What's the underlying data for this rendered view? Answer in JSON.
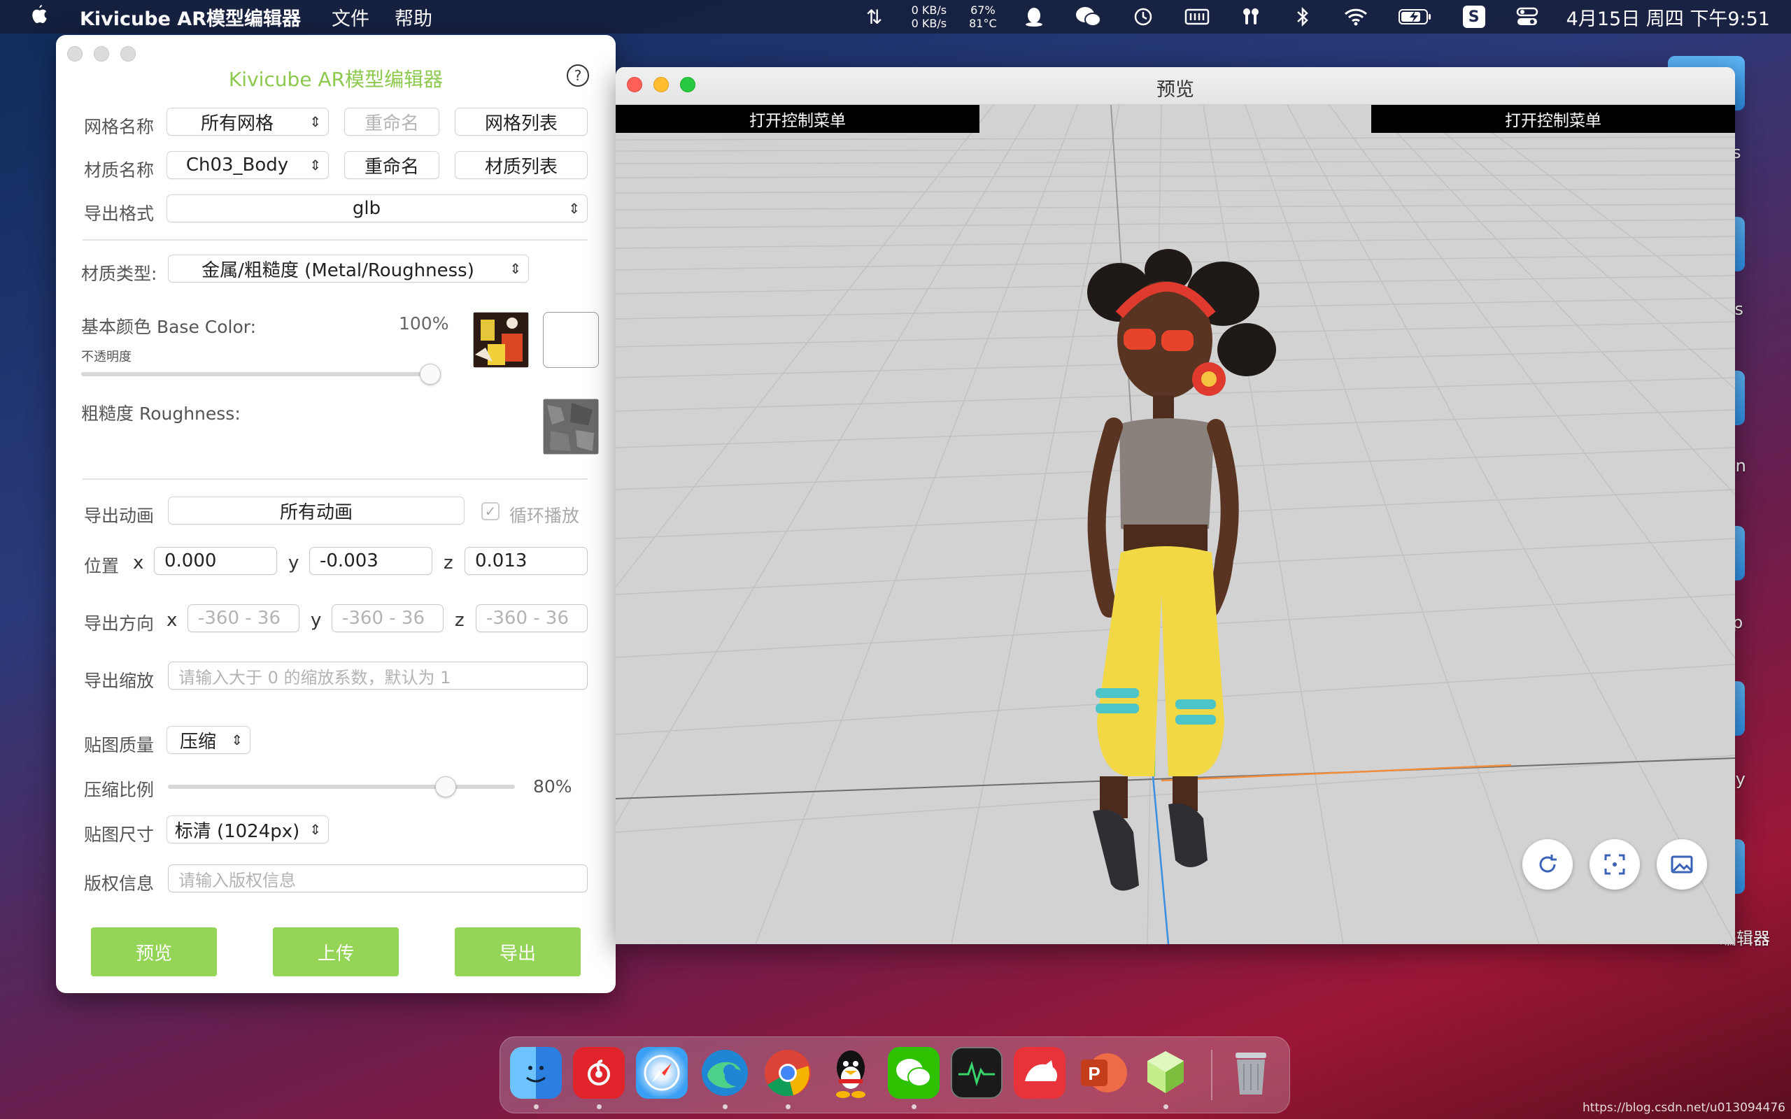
{
  "menubar": {
    "app_name": "Kivicube AR模型编辑器",
    "menus": [
      "文件",
      "帮助"
    ],
    "net_up": "0 KB/s",
    "net_down": "0 KB/s",
    "cpu_usage": "67%",
    "cpu_temp": "81°C",
    "clock": "4月15日 周四 下午9:51"
  },
  "editor": {
    "title": "Kivicube AR模型编辑器",
    "mesh_label": "网格名称",
    "mesh_value": "所有网格",
    "mesh_rename": "重命名",
    "mesh_list": "网格列表",
    "material_label": "材质名称",
    "material_value": "Ch03_Body",
    "material_rename": "重命名",
    "material_list": "材质列表",
    "export_format_label": "导出格式",
    "export_format_value": "glb",
    "material_type_label": "材质类型:",
    "material_type_value": "金属/粗糙度 (Metal/Roughness)",
    "base_color_label": "基本颜色 Base Color:",
    "base_color_percent": "100%",
    "opacity_label": "不透明度",
    "opacity_value": 1.0,
    "roughness_label": "粗糙度 Roughness:",
    "anim_label": "导出动画",
    "anim_value": "所有动画",
    "loop_label": "循环播放",
    "position_label": "位置",
    "pos_x_label": "x",
    "pos_x": "0.000",
    "pos_y_label": "y",
    "pos_y": "-0.003",
    "pos_z_label": "z",
    "pos_z": "0.013",
    "rotation_label": "导出方向",
    "rot_x_label": "x",
    "rot_y_label": "y",
    "rot_z_label": "z",
    "rot_placeholder": "-360 - 36",
    "scale_label": "导出缩放",
    "scale_placeholder": "请输入大于 0 的缩放系数，默认为 1",
    "tex_quality_label": "贴图质量",
    "tex_quality_value": "压缩",
    "compress_label": "压缩比例",
    "compress_value_text": "80%",
    "compress_value": 0.8,
    "tex_size_label": "贴图尺寸",
    "tex_size_value": "标清 (1024px)",
    "copyright_label": "版权信息",
    "copyright_placeholder": "请输入版权信息",
    "btn_preview": "预览",
    "btn_upload": "上传",
    "btn_export": "导出",
    "accent_color": "#94d457"
  },
  "preview": {
    "title": "预览",
    "menu_left": "打开控制菜单",
    "menu_right": "打开控制菜单"
  },
  "desktop": {
    "labels": [
      "s",
      "ts",
      "on",
      "p",
      "ay",
      "编辑器"
    ],
    "watermark": "https://blog.csdn.net/u013094476"
  },
  "dock": {
    "apps": [
      "finder-icon",
      "netease-music-icon",
      "safari-icon",
      "edge-icon",
      "chrome-icon",
      "qq-icon",
      "wechat-icon",
      "activity-monitor-icon",
      "bear-icon",
      "powerpoint-icon",
      "kivicube-icon",
      "trash-icon"
    ]
  }
}
